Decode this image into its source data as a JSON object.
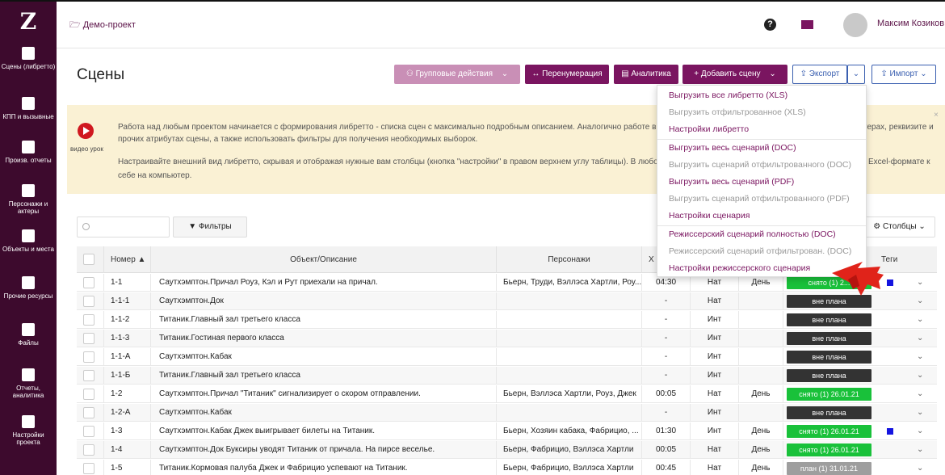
{
  "header": {
    "breadcrumb": "Демо-проект",
    "help_glyph": "?",
    "user_name": "Максим Козиков"
  },
  "sidebar": {
    "logo": "Z",
    "items": [
      {
        "label": "Сцены (либретто)",
        "icon": "film-icon"
      },
      {
        "label": "КПП и вызывные",
        "icon": "calendar-icon"
      },
      {
        "label": "Произв. отчеты",
        "icon": "check-icon"
      },
      {
        "label": "Персонажи и актеры",
        "icon": "people-icon"
      },
      {
        "label": "Объекты и места",
        "icon": "image-icon"
      },
      {
        "label": "Прочие ресурсы",
        "icon": "box-icon"
      },
      {
        "label": "Файлы",
        "icon": "file-icon"
      },
      {
        "label": "Отчеты, аналитика",
        "icon": "chart-icon"
      },
      {
        "label": "Настройки проекта",
        "icon": "sliders-icon"
      }
    ]
  },
  "page": {
    "title": "Сцены",
    "buttons": {
      "group_actions": "Групповые действия",
      "renumber": "↔ Перенумерация",
      "analytics": "Аналитика",
      "add_scene": "+ Добавить сцену",
      "export": "Экспорт",
      "import": "Импорт"
    }
  },
  "banner": {
    "video_label": "видео урок",
    "line1": "Работа над любым проектом начинается с формирования либретто - списка сцен с максимально подробным описанием. Аналогично работе в",
    "line1_tail": "терах, реквизите и",
    "line2": "прочих атрибутах сцены, а также использовать фильтры для получения необходимых выборок.",
    "line3": "Настраивайте внешний вид либретто, скрывая и отображая нужные вам столбцы (кнопка \"настройки\" в правом верхнем углу таблицы). В любо",
    "line3_tail": "Excel-формате к",
    "line4": "себе на компьютер.",
    "close": "×"
  },
  "toolbar": {
    "search_placeholder": "",
    "filters": "Фильтры",
    "columns": "Столбцы"
  },
  "table": {
    "headers": {
      "number": "Номер ▲",
      "object": "Объект/Описание",
      "characters": "Персонажи",
      "x": "Х",
      "tags": "Теги"
    },
    "rows": [
      {
        "num": "1-1",
        "obj": "Саутхэмптон.Причал Роуз, Кэл и Рут приехали на причал.",
        "chars": "Бьерн, Труди, Вэллэса Хартли, Роу...",
        "time": "04:30",
        "place": "Нат",
        "day": "День",
        "status": "снято (1) 2...",
        "status_color": "#19c13a",
        "tag": true
      },
      {
        "num": "1-1-1",
        "obj": "Саутхэмптон.Док",
        "chars": "",
        "time": "-",
        "place": "Нат",
        "day": "",
        "status": "вне плана",
        "status_color": "#333333",
        "tag": false
      },
      {
        "num": "1-1-2",
        "obj": "Титаник.Главный зал третьего класса",
        "chars": "",
        "time": "-",
        "place": "Инт",
        "day": "",
        "status": "вне плана",
        "status_color": "#333333",
        "tag": false
      },
      {
        "num": "1-1-3",
        "obj": "Титаник.Гостиная первого класса",
        "chars": "",
        "time": "-",
        "place": "Инт",
        "day": "",
        "status": "вне плана",
        "status_color": "#333333",
        "tag": false
      },
      {
        "num": "1-1-А",
        "obj": "Саутхэмптон.Кабак",
        "chars": "",
        "time": "-",
        "place": "Инт",
        "day": "",
        "status": "вне плана",
        "status_color": "#333333",
        "tag": false
      },
      {
        "num": "1-1-Б",
        "obj": "Титаник.Главный зал третьего класса",
        "chars": "",
        "time": "-",
        "place": "Инт",
        "day": "",
        "status": "вне плана",
        "status_color": "#333333",
        "tag": false
      },
      {
        "num": "1-2",
        "obj": "Саутхэмптон.Причал \"Титаник\" сигнализирует о скором отправлении.",
        "chars": "Бьерн, Вэллэса Хартли, Роуз, Джек",
        "time": "00:05",
        "place": "Нат",
        "day": "День",
        "status": "снято (1) 26.01.21",
        "status_color": "#19c13a",
        "tag": false
      },
      {
        "num": "1-2-А",
        "obj": "Саутхэмптон.Кабак",
        "chars": "",
        "time": "-",
        "place": "Инт",
        "day": "",
        "status": "вне плана",
        "status_color": "#333333",
        "tag": false
      },
      {
        "num": "1-3",
        "obj": "Саутхэмптон.Кабак Джек выигрывает билеты на Титаник.",
        "chars": "Бьерн, Хозяин кабака, Фабрицио, ...",
        "time": "01:30",
        "place": "Инт",
        "day": "День",
        "status": "снято (1) 26.01.21",
        "status_color": "#19c13a",
        "tag": true
      },
      {
        "num": "1-4",
        "obj": "Саутхэмптон.Док Буксиры уводят Титаник от причала. На пирсе веселье.",
        "chars": "Бьерн, Фабрицио, Вэллэса Хартли",
        "time": "00:05",
        "place": "Нат",
        "day": "День",
        "status": "снято (1) 26.01.21",
        "status_color": "#19c13a",
        "tag": false
      },
      {
        "num": "1-5",
        "obj": "Титаник.Кормовая палуба Джек и Фабрицио успевают на Титаник.",
        "chars": "Бьерн, Фабрицио, Вэллэса Хартли",
        "time": "00:45",
        "place": "Нат",
        "day": "День",
        "status": "план (1) 31.01.21",
        "status_color": "#9e9e9e",
        "tag": false
      }
    ]
  },
  "export_menu": {
    "items": [
      {
        "label": "Выгрузить все либретто (XLS)",
        "enabled": true
      },
      {
        "label": "Выгрузить отфильтрованное (XLS)",
        "enabled": false
      },
      {
        "label": "Настройки либретто",
        "enabled": true
      },
      {
        "label": "Выгрузить весь сценарий (DOC)",
        "enabled": true
      },
      {
        "label": "Выгрузить сценарий отфильтрованного (DOC)",
        "enabled": false
      },
      {
        "label": "Выгрузить весь сценарий (PDF)",
        "enabled": true
      },
      {
        "label": "Выгрузить сценарий отфильтрованного (PDF)",
        "enabled": false
      },
      {
        "label": "Настройки сценария",
        "enabled": true
      },
      {
        "label": "Режиссерский сценарий полностью (DOC)",
        "enabled": true
      },
      {
        "label": "Режиссерский сценарий отфильтрован. (DOC)",
        "enabled": false
      },
      {
        "label": "Настройки режиссерского сценария",
        "enabled": true
      }
    ]
  },
  "colors": {
    "brand": "#7a1560",
    "sidebar": "#3d0a2d",
    "banner": "#faf1d4",
    "pointer": "#e0231a"
  }
}
